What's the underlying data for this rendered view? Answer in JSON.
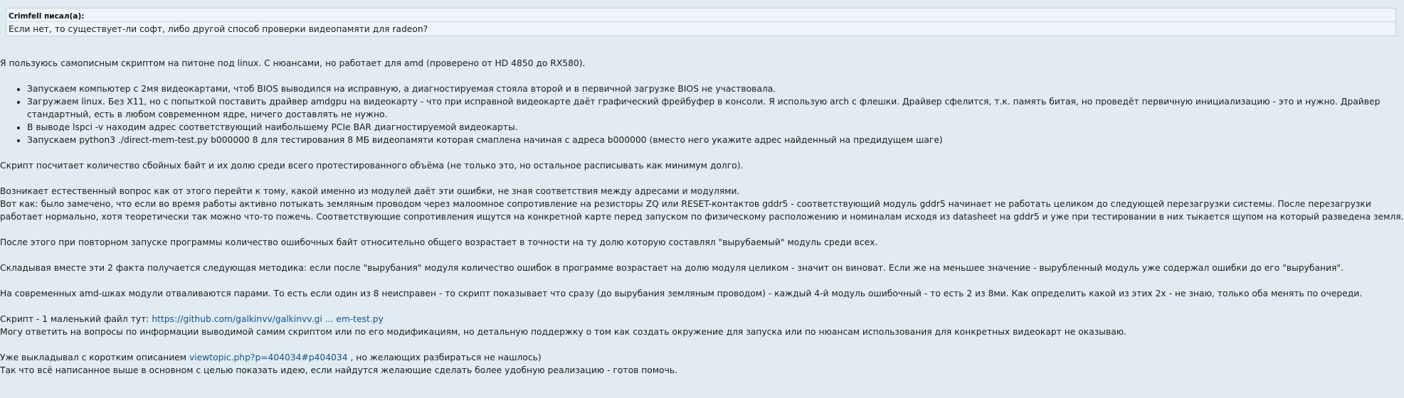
{
  "quote": {
    "author": "Crimfell писал(а):",
    "text": "Если нет, то существует-ли софт, либо другой способ проверки видеопамяти для radeon?"
  },
  "post": {
    "intro": "Я пользуюсь самописным скриптом на питоне под linux. С нюансами, но работает для amd (проверено от HD 4850 до RX580).",
    "steps": [
      "Запускаем компьютер с 2мя видеокартами, чтоб BIOS выводился на исправную, а диагностируемая стояла второй и в первичной загрузке BIOS не участвовала.",
      "Загружаем linux. Без X11, но с попыткой поставить драйвер amdgpu на видеокарту - что при исправной видеокарте даёт графический фрейбуфер в консоли. Я использую arch с флешки. Драйвер сфелится, т.к. память битая, но проведёт первичную инициализацию - это и нужно. Драйвер стандартный, есть в любом современном ядре, ничего доставлять не нужно.",
      "В выводе lspci -v находим адрес соответствующий наибольшему PCIe BAR диагностируемой видеокарты.",
      "Запускаем python3 ./direct-mem-test.py b000000 8 для тестирования 8 МБ видеопамяти которая смаплена начиная с адреса b000000 (вместо него укажите адрес найденный на предидущем шаге)"
    ],
    "p_script_counts": "Скрипт посчитает количество сбойных байт и их долю среди всего протестированного объёма (не только это, но остальное расписывать как минимум долго).",
    "p_question": "Возникает естественный вопрос как от этого перейти к тому, какой именно из модулей даёт эти ошибки, не зная соответствия между адресами и модулями.",
    "p_noticed": "Вот как: было замечено, что если во время работы активно потыкать земляным проводом через малоомное сопротивление на резисторы ZQ или RESET-контактов gddr5 - соответствующий модуль gddr5 начинает не работать целиком до следующей перезагрузки системы. После перезагрузки работает нормально, хотя теоретически так можно что-то пожечь. Соответствующие сопротивления ищутся на конкретной карте перед запуском по физическому расположению и номиналам исходя из datasheet на gddr5 и уже при тестировании в них тыкается щупом на который разведена земля.",
    "p_after": "После этого при повторном запуске программы количество ошибочных байт относительно общего возрастает в точности на ту долю которую составлял \"вырубаемый\" модуль среди всех.",
    "p_method": "Складывая вместе эти 2 факта получается следующая методика: если после \"вырубания\" модуля количество ошибок в программе возрастает на долю модуля целиком - значит он виноват. Если же на меньшее значение - вырубленный модуль уже содержал ошибки до его \"вырубания\".",
    "p_pairs": "На современных amd-шках модули отваливаются парами. То есть если один из 8 неисправен - то скрипт показывает что сразу (до вырубания земляным проводом) - каждый 4-й модуль ошибочный - то есть 2 из 8ми. Как определить какой из этих 2х - не знаю, только оба менять по очереди.",
    "p_link_prefix": "Скрипт - 1 маленький файл тут: ",
    "p_link_text": "https://github.com/galkinvv/galkinvv.gi ... em-test.py",
    "p_support": "Могу ответить на вопросы по информации выводимой самим скриптом или по его модификациям, но детальную поддержку о том как создать окружение для запуска или по нюансам использования для конкретных видеокарт не оказываю.",
    "p_posted_prefix": "Уже выкладывал с коротким описанием ",
    "p_posted_link": "viewtopic.php?p=404034#p404034",
    "p_posted_suffix": " , но желающих разбираться не нашлось)",
    "p_closing": "Так что всё написанное выше в основном с целью показать идею, если найдутся желающие сделать более удобную реализацию - готов помочь."
  }
}
